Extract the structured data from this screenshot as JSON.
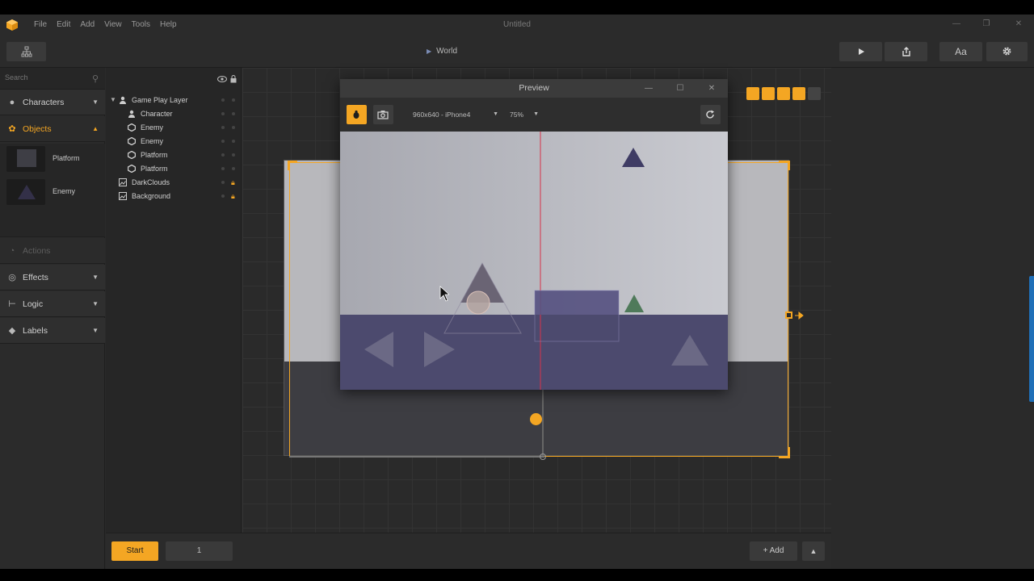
{
  "menu": [
    "File",
    "Edit",
    "Add",
    "View",
    "Tools",
    "Help"
  ],
  "window_title": "Untitled",
  "window_controls": {
    "minimize": "—",
    "restore": "❐",
    "close": "✕"
  },
  "toolbar": {
    "world_label": "World",
    "font_button": "Aa"
  },
  "sidebar": {
    "search_placeholder": "Search",
    "categories": {
      "characters": "Characters",
      "objects": "Objects",
      "actions": "Actions",
      "effects": "Effects",
      "logic": "Logic",
      "labels": "Labels"
    },
    "objects": [
      {
        "label": "Platform"
      },
      {
        "label": "Enemy"
      }
    ]
  },
  "layers": {
    "root": "Game Play Layer",
    "children": [
      "Character",
      "Enemy",
      "Enemy",
      "Platform",
      "Platform"
    ],
    "others": [
      "DarkClouds",
      "Background"
    ]
  },
  "preview": {
    "title": "Preview",
    "resolution": "960x640 - iPhone4",
    "zoom": "75%"
  },
  "bottom": {
    "start_label": "Start",
    "page_value": "1",
    "add_label": "+ Add"
  },
  "colors": {
    "accent": "#f4a623",
    "panel": "#2b2b2b",
    "canvas": "#2a2a2a",
    "ground": "#4c4a6e"
  }
}
